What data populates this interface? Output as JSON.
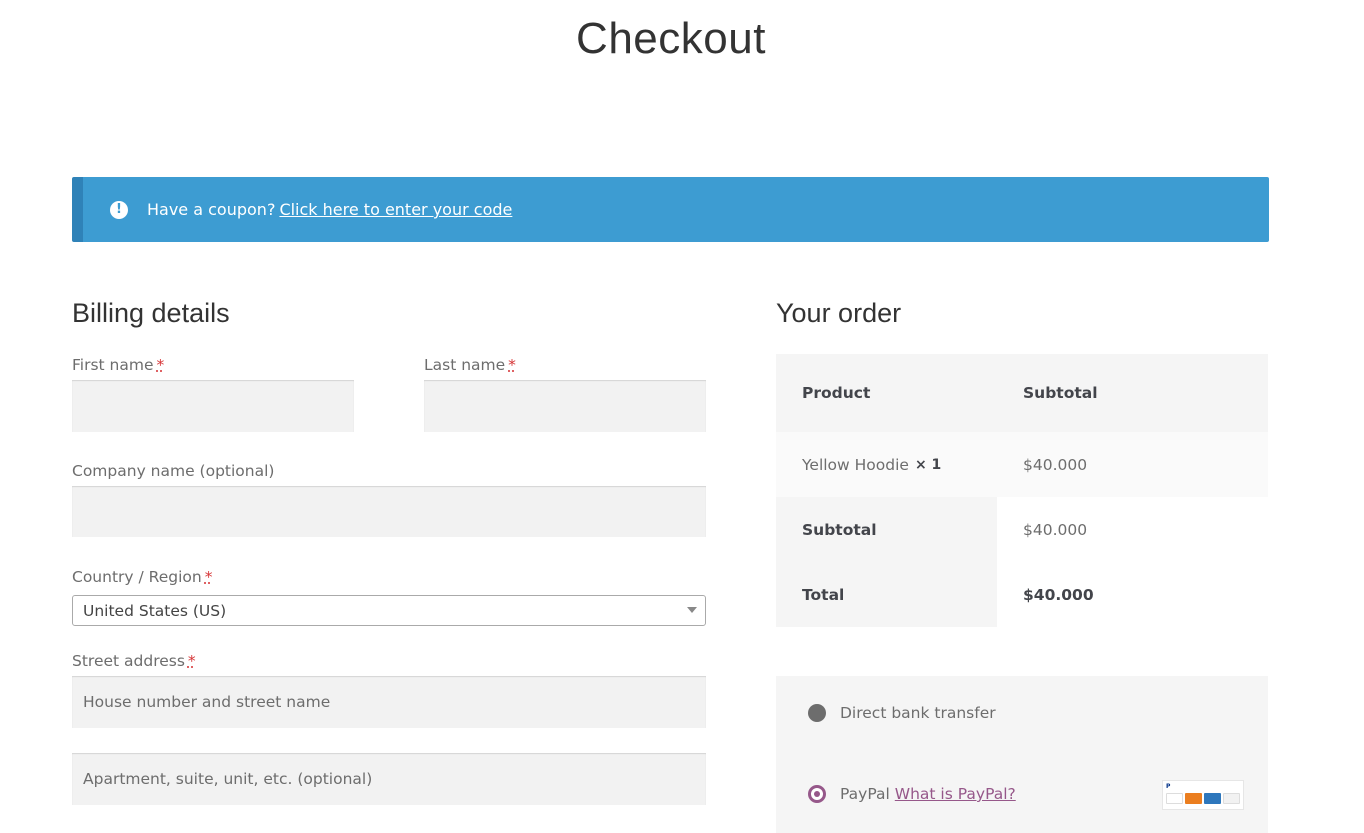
{
  "page": {
    "title": "Checkout"
  },
  "notice": {
    "icon": "info-icon",
    "text": "Have a coupon?",
    "link": "Click here to enter your code",
    "color": "#3d9cd2"
  },
  "billing": {
    "heading": "Billing details",
    "required_mark": "*",
    "first_name": {
      "label": "First name",
      "value": ""
    },
    "last_name": {
      "label": "Last name",
      "value": ""
    },
    "company": {
      "label": "Company name (optional)",
      "value": ""
    },
    "country": {
      "label": "Country / Region",
      "selected": "United States (US)"
    },
    "street": {
      "label": "Street address",
      "line1_placeholder": "House number and street name",
      "line2_placeholder": "Apartment, suite, unit, etc. (optional)"
    }
  },
  "order": {
    "heading": "Your order",
    "columns": {
      "product": "Product",
      "subtotal": "Subtotal"
    },
    "items": [
      {
        "name": "Yellow Hoodie",
        "qty": "× 1",
        "price": "$40.000"
      }
    ],
    "subtotal": {
      "label": "Subtotal",
      "value": "$40.000"
    },
    "total": {
      "label": "Total",
      "value": "$40.000"
    }
  },
  "payment": {
    "methods": [
      {
        "label": "Direct bank transfer",
        "selected": false
      },
      {
        "label": "PayPal",
        "link": "What is PayPal?",
        "selected": true,
        "icon": "credit-cards-icon"
      }
    ],
    "accent_color": "#96588a"
  }
}
